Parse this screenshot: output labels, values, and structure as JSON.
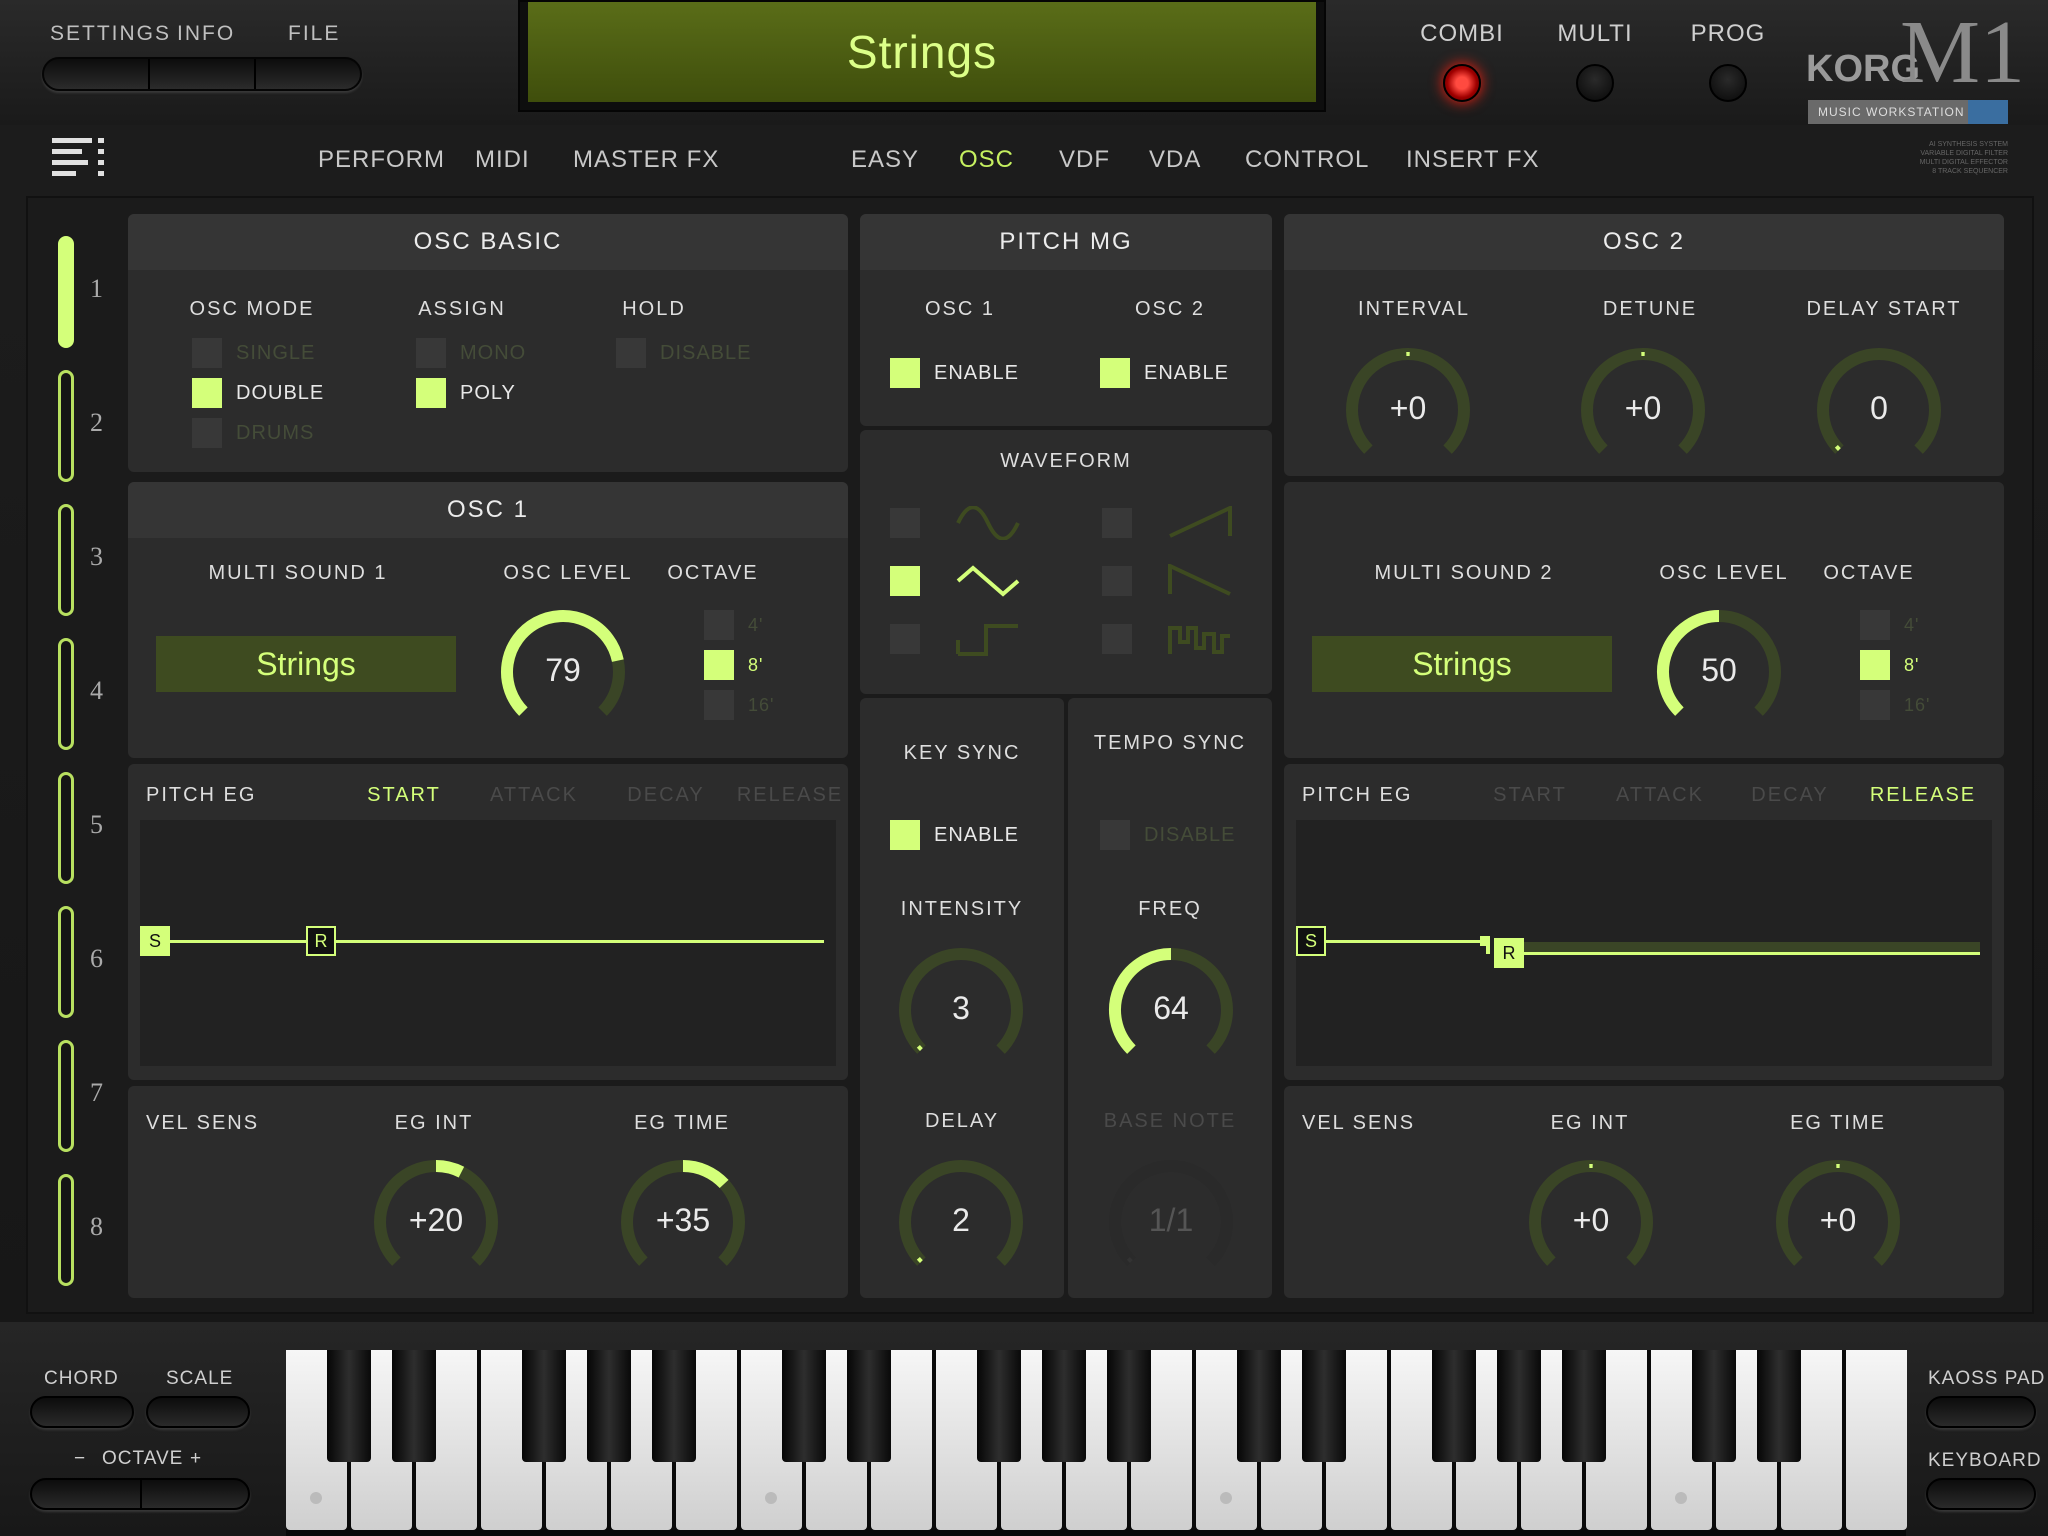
{
  "menu": {
    "settings": "SETTINGS",
    "info": "INFO",
    "file": "FILE"
  },
  "program_name": "Strings",
  "modes": {
    "combi": "COMBI",
    "multi": "MULTI",
    "prog": "PROG",
    "active": "COMBI"
  },
  "brand": {
    "korg": "KORG",
    "model": "M1",
    "badge": "MUSIC WORKSTATION",
    "tagline": [
      "AI SYNTHESIS SYSTEM",
      "VARIABLE DIGITAL FILTER",
      "MULTI DIGITAL EFFECTOR",
      "8 TRACK SEQUENCER"
    ]
  },
  "tabs_left": [
    "PERFORM",
    "MIDI",
    "MASTER FX"
  ],
  "tabs_right": [
    "EASY",
    "OSC",
    "VDF",
    "VDA",
    "CONTROL",
    "INSERT FX"
  ],
  "active_tab": "OSC",
  "slots": [
    "1",
    "2",
    "3",
    "4",
    "5",
    "6",
    "7",
    "8"
  ],
  "active_slot": "1",
  "osc_basic": {
    "title": "OSC BASIC",
    "osc_mode": {
      "label": "OSC MODE",
      "options": [
        "SINGLE",
        "DOUBLE",
        "DRUMS"
      ],
      "selected": "DOUBLE"
    },
    "assign": {
      "label": "ASSIGN",
      "options": [
        "MONO",
        "POLY"
      ],
      "selected": "POLY"
    },
    "hold": {
      "label": "HOLD",
      "options": [
        "DISABLE"
      ],
      "selected": ""
    }
  },
  "pitch_mg": {
    "title": "PITCH MG",
    "osc1": {
      "label": "OSC 1",
      "enable": "ENABLE",
      "on": true
    },
    "osc2": {
      "label": "OSC 2",
      "enable": "ENABLE",
      "on": true
    },
    "waveform": {
      "label": "WAVEFORM",
      "options": [
        "sine",
        "triangle",
        "square",
        "saw-up",
        "saw-down",
        "random"
      ],
      "selected": "triangle"
    },
    "key_sync": {
      "label": "KEY SYNC",
      "enable": "ENABLE",
      "on": true
    },
    "tempo_sync": {
      "label": "TEMPO SYNC",
      "disable": "DISABLE",
      "on": false
    },
    "intensity": {
      "label": "INTENSITY",
      "value": "3",
      "level": 0.03
    },
    "freq": {
      "label": "FREQ",
      "value": "64",
      "level": 0.5
    },
    "delay": {
      "label": "DELAY",
      "value": "2",
      "level": 0.02
    },
    "base_note": {
      "label": "BASE NOTE",
      "value": "1/1",
      "level": 0.0
    }
  },
  "osc1": {
    "title": "OSC 1",
    "multisound_label": "MULTI SOUND 1",
    "multisound": "Strings",
    "level_label": "OSC LEVEL",
    "level": "79",
    "level_frac": 0.79,
    "octave_label": "OCTAVE",
    "octave_options": [
      "4'",
      "8'",
      "16'"
    ],
    "octave_selected": "8'",
    "pitch_eg": {
      "label": "PITCH EG",
      "tabs": [
        "START",
        "ATTACK",
        "DECAY",
        "RELEASE"
      ],
      "active": "START",
      "s_marker": "S",
      "r_marker": "R"
    },
    "vel_sens": "VEL SENS",
    "eg_int": {
      "label": "EG INT",
      "value": "+20",
      "level": 0.2
    },
    "eg_time": {
      "label": "EG TIME",
      "value": "+35",
      "level": 0.35
    }
  },
  "osc2": {
    "title": "OSC 2",
    "interval": {
      "label": "INTERVAL",
      "value": "+0",
      "level": 0.0
    },
    "detune": {
      "label": "DETUNE",
      "value": "+0",
      "level": 0.0
    },
    "delay_start": {
      "label": "DELAY START",
      "value": "0",
      "level": 0.0
    },
    "multisound_label": "MULTI SOUND 2",
    "multisound": "Strings",
    "level_label": "OSC LEVEL",
    "level": "50",
    "level_frac": 0.5,
    "octave_label": "OCTAVE",
    "octave_options": [
      "4'",
      "8'",
      "16'"
    ],
    "octave_selected": "8'",
    "pitch_eg": {
      "label": "PITCH EG",
      "tabs": [
        "START",
        "ATTACK",
        "DECAY",
        "RELEASE"
      ],
      "active": "RELEASE",
      "s_marker": "S",
      "r_marker": "R"
    },
    "vel_sens": "VEL SENS",
    "eg_int": {
      "label": "EG INT",
      "value": "+0",
      "level": 0.0
    },
    "eg_time": {
      "label": "EG TIME",
      "value": "+0",
      "level": 0.0
    }
  },
  "bottom": {
    "chord": "CHORD",
    "scale": "SCALE",
    "octave": "OCTAVE",
    "octave_minus": "−",
    "octave_plus": "+",
    "kaoss_pad": "KAOSS PAD",
    "keyboard": "KEYBOARD"
  },
  "colors": {
    "accent": "#d4ff7a",
    "knob_track": "#3a4526",
    "panel": "#2c2c2c",
    "led_red": "#ff3020"
  }
}
